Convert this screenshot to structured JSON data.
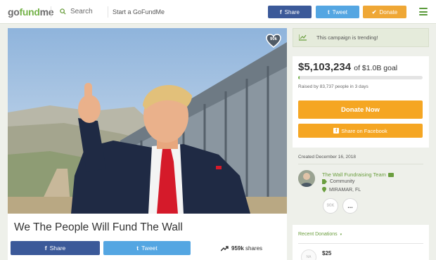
{
  "topbar": {
    "logo_go": "go",
    "logo_fund": "fund",
    "logo_me": "me",
    "search_label": "Search",
    "start_label": "Start a GoFundMe",
    "share_icon": "f",
    "share_label": "Share",
    "tweet_icon": "t",
    "tweet_label": "Tweet",
    "donate_icon": "✔",
    "donate_label": "Donate"
  },
  "campaign": {
    "heart_count": "90k",
    "title": "We The People Will Fund The Wall",
    "share_icon": "f",
    "share_label": "Share",
    "tweet_icon": "t",
    "tweet_label": "Tweet",
    "shares_count": "959k",
    "shares_label": "shares"
  },
  "trending": {
    "text": "This campaign is trending!"
  },
  "donation": {
    "raised": "$5,103,234",
    "goal": "of $1.0B goal",
    "progress_fraction": 0.005,
    "raised_by": "Raised by 83,737 people in 3 days",
    "donate_button": "Donate Now",
    "share_fb_icon": "f",
    "share_fb_button": "Share on Facebook"
  },
  "organizer": {
    "created": "Created December 16, 2018",
    "name": "The Wall Fundraising Team",
    "category": "Community",
    "location": "MIRAMAR, FL",
    "circle_1": "90K",
    "circle_2": "..."
  },
  "recent_donations": {
    "heading": "Recent Donations",
    "caret": "▾",
    "first_avatar": "NA",
    "first_amount": "$25"
  },
  "colors": {
    "brand_green": "#75b34a",
    "facebook_blue": "#3b5999",
    "twitter_blue": "#54a6e2",
    "donate_orange": "#f5a623"
  }
}
